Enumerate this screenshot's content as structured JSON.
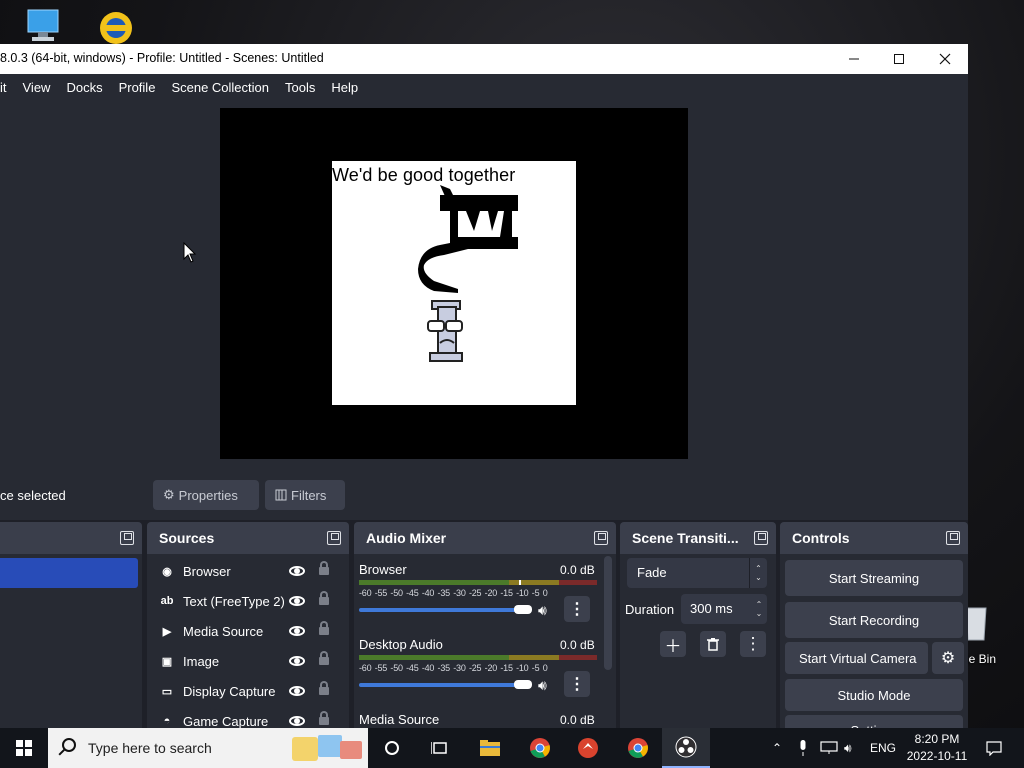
{
  "desktop": {
    "recycle_bin_label": "cle Bin"
  },
  "window": {
    "title": "8.0.3 (64-bit, windows) - Profile: Untitled - Scenes: Untitled",
    "menu": [
      "it",
      "View",
      "Docks",
      "Profile",
      "Scene Collection",
      "Tools",
      "Help"
    ]
  },
  "preview": {
    "canvas_text": "We'd be good together"
  },
  "source_toolbar": {
    "selection_label": "ce selected",
    "properties_label": "Properties",
    "filters_label": "Filters"
  },
  "docks": {
    "sources": {
      "title": "Sources",
      "items": [
        {
          "label": "Browser",
          "icon": "globe-icon"
        },
        {
          "label": "Text (FreeType 2)",
          "icon": "text-icon"
        },
        {
          "label": "Media Source",
          "icon": "play-icon"
        },
        {
          "label": "Image",
          "icon": "image-icon"
        },
        {
          "label": "Display Capture",
          "icon": "monitor-icon"
        },
        {
          "label": "Game Capture",
          "icon": "gamepad-icon"
        }
      ]
    },
    "audio_mixer": {
      "title": "Audio Mixer",
      "scale": "-60 -55 -50 -45 -40 -35 -30 -25 -20 -15 -10 -5 0",
      "channels": [
        {
          "name": "Browser",
          "db": "0.0 dB"
        },
        {
          "name": "Desktop Audio",
          "db": "0.0 dB"
        },
        {
          "name": "Media Source",
          "db": "0.0 dB"
        }
      ]
    },
    "transitions": {
      "title": "Scene Transiti...",
      "selected": "Fade",
      "duration_label": "Duration",
      "duration_value": "300 ms"
    },
    "controls": {
      "title": "Controls",
      "start_streaming": "Start Streaming",
      "start_recording": "Start Recording",
      "start_virtual_camera": "Start Virtual Camera",
      "studio_mode": "Studio Mode",
      "settings": "Settings"
    }
  },
  "taskbar": {
    "search_placeholder": "Type here to search",
    "language": "ENG",
    "time": "8:20 PM",
    "date": "2022-10-11"
  },
  "colors": {
    "accent_blue": "#284cb8",
    "panel_bg": "#272a33",
    "dock_header": "#3a3e4b",
    "button_bg": "#3c404d"
  }
}
